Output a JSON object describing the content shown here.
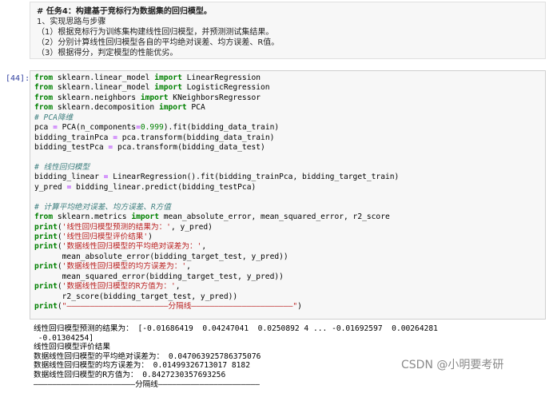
{
  "markdown": {
    "title": "# 任务4：构建基于竞标行为数据集的回归模型。",
    "lines": [
      "1、实现思路与步骤",
      "（1）根据竞标行为训练集构建线性回归模型，并预测测试集结果。",
      "（2）分别计算线性回归模型各自的平均绝对误差、均方误差、R值。",
      "（3）根据得分，判定模型的性能优劣。"
    ]
  },
  "cell": {
    "prompt": "[44]:",
    "code_lines": [
      [
        {
          "t": "from",
          "c": "kw"
        },
        {
          "t": " sklearn.linear_model "
        },
        {
          "t": "import",
          "c": "kw"
        },
        {
          "t": " LinearRegression"
        }
      ],
      [
        {
          "t": "from",
          "c": "kw"
        },
        {
          "t": " sklearn.linear_model "
        },
        {
          "t": "import",
          "c": "kw"
        },
        {
          "t": " LogisticRegression"
        }
      ],
      [
        {
          "t": "from",
          "c": "kw"
        },
        {
          "t": " sklearn.neighbors "
        },
        {
          "t": "import",
          "c": "kw"
        },
        {
          "t": " KNeighborsRegressor"
        }
      ],
      [
        {
          "t": "from",
          "c": "kw"
        },
        {
          "t": " sklearn.decomposition "
        },
        {
          "t": "import",
          "c": "kw"
        },
        {
          "t": " PCA"
        }
      ],
      [
        {
          "t": "# PCA降维",
          "c": "cm"
        }
      ],
      [
        {
          "t": "pca "
        },
        {
          "t": "=",
          "c": "op"
        },
        {
          "t": " PCA(n_components"
        },
        {
          "t": "=",
          "c": "op"
        },
        {
          "t": "0.999",
          "c": "nm"
        },
        {
          "t": ").fit(bidding_data_train)"
        }
      ],
      [
        {
          "t": "bidding_trainPca "
        },
        {
          "t": "=",
          "c": "op"
        },
        {
          "t": " pca.transform(bidding_data_train)"
        }
      ],
      [
        {
          "t": "bidding_testPca "
        },
        {
          "t": "=",
          "c": "op"
        },
        {
          "t": " pca.transform(bidding_data_test)"
        }
      ],
      [],
      [
        {
          "t": "# 线性回归模型",
          "c": "cm"
        }
      ],
      [
        {
          "t": "bidding_linear "
        },
        {
          "t": "=",
          "c": "op"
        },
        {
          "t": " LinearRegression().fit(bidding_trainPca, bidding_target_train)"
        }
      ],
      [
        {
          "t": "y_pred "
        },
        {
          "t": "=",
          "c": "op"
        },
        {
          "t": " bidding_linear.predict(bidding_testPca)"
        }
      ],
      [],
      [
        {
          "t": "# 计算平均绝对误差、均方误差、R方值",
          "c": "cm"
        }
      ],
      [
        {
          "t": "from",
          "c": "kw"
        },
        {
          "t": " sklearn.metrics "
        },
        {
          "t": "import",
          "c": "kw"
        },
        {
          "t": " mean_absolute_error, mean_squared_error, r2_score"
        }
      ],
      [
        {
          "t": "print",
          "c": "kw"
        },
        {
          "t": "("
        },
        {
          "t": "'线性回归模型预测的结果为：'",
          "c": "st"
        },
        {
          "t": ", y_pred)"
        }
      ],
      [
        {
          "t": "print",
          "c": "kw"
        },
        {
          "t": "("
        },
        {
          "t": "'线性回归模型评价结果'",
          "c": "st"
        },
        {
          "t": ")"
        }
      ],
      [
        {
          "t": "print",
          "c": "kw"
        },
        {
          "t": "("
        },
        {
          "t": "'数据线性回归模型的平均绝对误差为：'",
          "c": "st"
        },
        {
          "t": ","
        }
      ],
      [
        {
          "t": "      mean_absolute_error(bidding_target_test, y_pred))"
        }
      ],
      [
        {
          "t": "print",
          "c": "kw"
        },
        {
          "t": "("
        },
        {
          "t": "'数据线性回归模型的均方误差为：'",
          "c": "st"
        },
        {
          "t": ","
        }
      ],
      [
        {
          "t": "      mean_squared_error(bidding_target_test, y_pred))"
        }
      ],
      [
        {
          "t": "print",
          "c": "kw"
        },
        {
          "t": "("
        },
        {
          "t": "'数据线性回归模型的R方值为：'",
          "c": "st"
        },
        {
          "t": ","
        }
      ],
      [
        {
          "t": "      r2_score(bidding_target_test, y_pred))"
        }
      ],
      [
        {
          "t": "print",
          "c": "kw"
        },
        {
          "t": "("
        },
        {
          "t": "\"——————————————————————分隔线——————————————————————\"",
          "c": "st"
        },
        {
          "t": ")"
        }
      ]
    ],
    "output_lines": [
      "线性回归模型预测的结果为： [-0.01686419  0.04247041  0.0250892 4 ... -0.01692597  0.00264281",
      " -0.01304254]",
      "线性回归模型评价结果",
      "数据线性回归模型的平均绝对误差为： 0.047063925786375076",
      "数据线性回归模型的均方误差为： 0.01499326713017 8182",
      "数据线性回归模型的R方值为： 0.8427230357693256",
      "——————————————————————分隔线——————————————————————"
    ]
  },
  "watermark": "CSDN @小明要考研"
}
